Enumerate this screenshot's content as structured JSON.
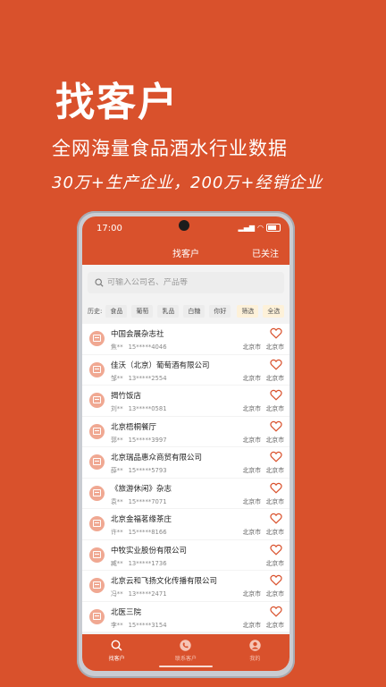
{
  "hero": {
    "title": "找客户",
    "subtitle": "全网海量食品酒水行业数据",
    "tagline": "30万+生产企业，200万+经销企业"
  },
  "status": {
    "time": "17:00"
  },
  "nav": {
    "title": "找客户",
    "right_label": "已关注"
  },
  "search": {
    "placeholder": "可输入公司名、产品等"
  },
  "history": {
    "label": "历史:",
    "chips": [
      "食品",
      "葡萄",
      "乳品",
      "白糖",
      "你好"
    ],
    "filter_label": "筛选",
    "select_all_label": "全选"
  },
  "companies": [
    {
      "name": "中国会展杂志社",
      "contact": "焦**",
      "phone": "15*****4046",
      "city": "北京市",
      "city2": "北京市"
    },
    {
      "name": "佳沃（北京）葡萄酒有限公司",
      "contact": "邹**",
      "phone": "13*****2554",
      "city": "北京市",
      "city2": "北京市"
    },
    {
      "name": "揭竹饭店",
      "contact": "刘**",
      "phone": "13*****0581",
      "city": "北京市",
      "city2": "北京市"
    },
    {
      "name": "北京梧桐餐厅",
      "contact": "郭**",
      "phone": "15*****3997",
      "city": "北京市",
      "city2": "北京市"
    },
    {
      "name": "北京瑞品惠众商贸有限公司",
      "contact": "薛**",
      "phone": "15*****5793",
      "city": "北京市",
      "city2": "北京市"
    },
    {
      "name": "《旅游休闲》杂志",
      "contact": "袁**",
      "phone": "15*****7071",
      "city": "北京市",
      "city2": "北京市"
    },
    {
      "name": "北京金福茗缘茶庄",
      "contact": "许**",
      "phone": "15*****8166",
      "city": "北京市",
      "city2": "北京市"
    },
    {
      "name": "中牧实业股份有限公司",
      "contact": "臧**",
      "phone": "13*****1736",
      "city": "",
      "city2": "北京市"
    },
    {
      "name": "北京云和飞扬文化传播有限公司",
      "contact": "冯**",
      "phone": "13*****2471",
      "city": "北京市",
      "city2": "北京市"
    },
    {
      "name": "北医三院",
      "contact": "李**",
      "phone": "15*****3154",
      "city": "北京市",
      "city2": "北京市"
    }
  ],
  "tabs": [
    {
      "label": "找客户",
      "icon": "search-icon",
      "active": true
    },
    {
      "label": "联系客户",
      "icon": "phone-icon",
      "active": false
    },
    {
      "label": "我的",
      "icon": "user-icon",
      "active": false
    }
  ],
  "colors": {
    "brand": "#d9512c",
    "icon_bg": "#f0a892"
  }
}
